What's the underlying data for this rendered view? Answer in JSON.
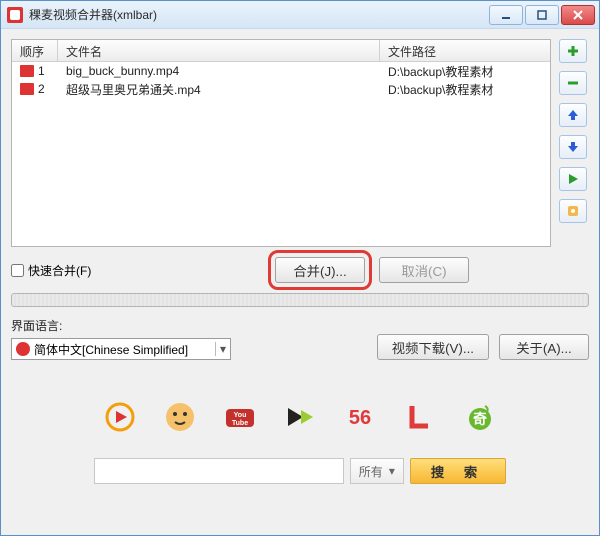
{
  "window": {
    "title": "稞麦视频合并器(xmlbar)"
  },
  "columns": {
    "seq": "顺序",
    "name": "文件名",
    "path": "文件路径"
  },
  "files": [
    {
      "seq": "1",
      "name": "big_buck_bunny.mp4",
      "path": "D:\\backup\\教程素材"
    },
    {
      "seq": "2",
      "name": "超级马里奥兄弟通关.mp4",
      "path": "D:\\backup\\教程素材"
    }
  ],
  "side": {
    "add": "add",
    "remove": "remove",
    "up": "up",
    "down": "down",
    "play": "play",
    "settings": "settings"
  },
  "actions": {
    "fast_merge_label": "快速合并(F)",
    "merge_label": "合并(J)...",
    "cancel_label": "取消(C)"
  },
  "language": {
    "label": "界面语言:",
    "value": "简体中文[Chinese Simplified]"
  },
  "buttons": {
    "video_download": "视频下载(V)...",
    "about": "关于(A)..."
  },
  "sites": [
    "site-1",
    "site-2",
    "youtube",
    "site-4",
    "56",
    "letv",
    "iqiyi"
  ],
  "search": {
    "filter": "所有",
    "search_label": "搜 索",
    "placeholder": ""
  }
}
